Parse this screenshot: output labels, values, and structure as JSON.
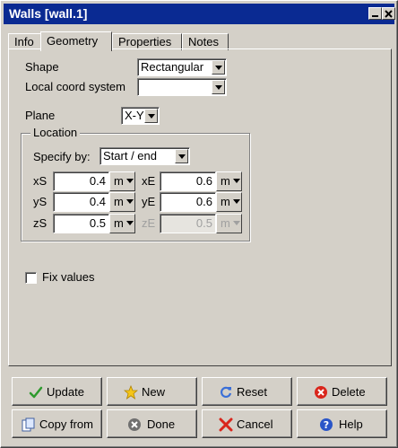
{
  "window": {
    "title": "Walls [wall.1]"
  },
  "tabs": [
    "Info",
    "Geometry",
    "Properties",
    "Notes"
  ],
  "active_tab": "Geometry",
  "geometry": {
    "shape_label": "Shape",
    "shape_value": "Rectangular",
    "local_coord_label": "Local coord system",
    "local_coord_value": "",
    "plane_label": "Plane",
    "plane_value": "X-Y",
    "location": {
      "legend": "Location",
      "specify_label": "Specify by:",
      "specify_value": "Start / end",
      "fields": {
        "xS": {
          "label": "xS",
          "value": "0.4",
          "unit": "m"
        },
        "yS": {
          "label": "yS",
          "value": "0.4",
          "unit": "m"
        },
        "zS": {
          "label": "zS",
          "value": "0.5",
          "unit": "m"
        },
        "xE": {
          "label": "xE",
          "value": "0.6",
          "unit": "m"
        },
        "yE": {
          "label": "yE",
          "value": "0.6",
          "unit": "m"
        },
        "zE": {
          "label": "zE",
          "value": "0.5",
          "unit": "m",
          "disabled": true
        }
      }
    },
    "fix_values_label": "Fix values",
    "fix_values_checked": false
  },
  "buttons": {
    "update": "Update",
    "new": "New",
    "reset": "Reset",
    "delete": "Delete",
    "copy_from": "Copy from",
    "done": "Done",
    "cancel": "Cancel",
    "help": "Help"
  },
  "colors": {
    "titlebar": "#0a2a92",
    "face": "#d4d0c8"
  }
}
